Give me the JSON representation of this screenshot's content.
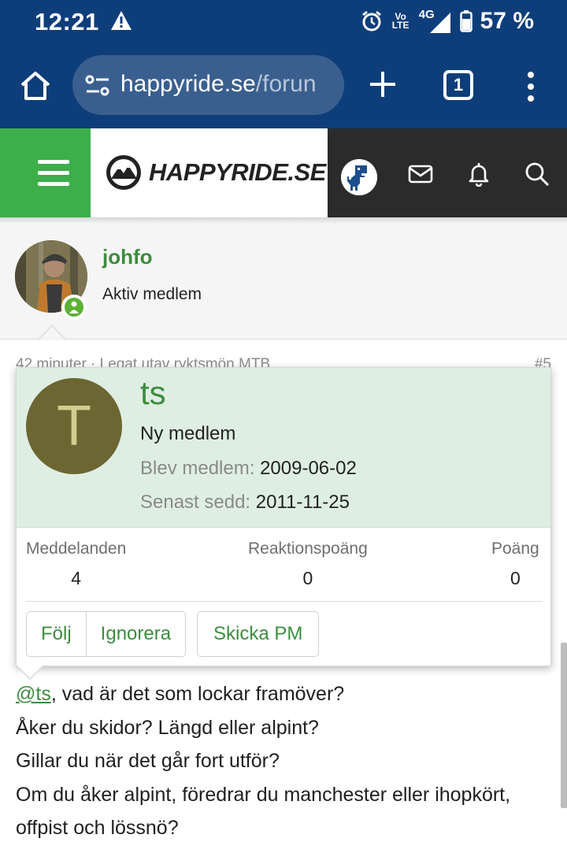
{
  "status_bar": {
    "time": "12:21",
    "volte": "Vo LTE",
    "network": "4G",
    "battery": "57 %"
  },
  "browser": {
    "url_host": "happyride.se",
    "url_path": "/forun",
    "tab_count": "1"
  },
  "site": {
    "logo_text": "HAPPYRIDE.SE",
    "colors": {
      "nav_green": "#3cae4a",
      "link_green": "#3d8c3f",
      "header_dark": "#2b2b2b",
      "browser_blue": "#0e3e7a"
    }
  },
  "poster": {
    "name": "johfo",
    "role": "Aktiv medlem"
  },
  "post_meta": {
    "left": "42 minuter · Legat utav ryktsmön MTB",
    "right": "#5"
  },
  "member_card": {
    "avatar_letter": "T",
    "username": "ts",
    "role": "Ny medlem",
    "joined_label": "Blev medlem:",
    "joined_value": "2009-06-02",
    "last_seen_label": "Senast sedd:",
    "last_seen_value": "2011-11-25",
    "stats": [
      {
        "label": "Meddelanden",
        "value": "4"
      },
      {
        "label": "Reaktionspoäng",
        "value": "0"
      },
      {
        "label": "Poäng",
        "value": "0"
      }
    ],
    "buttons": {
      "follow": "Följ",
      "ignore": "Ignorera",
      "send_pm": "Skicka PM"
    }
  },
  "post_body": {
    "mention": "@ts",
    "line1_rest": ", vad är det som lockar framöver?",
    "line2": "Åker du skidor? Längd eller alpint?",
    "line3": "Gillar du när det går fort utför?",
    "line4": "Om du åker alpint, föredrar du manchester eller ihopkört,",
    "line5": "offpist och lössnö?"
  }
}
